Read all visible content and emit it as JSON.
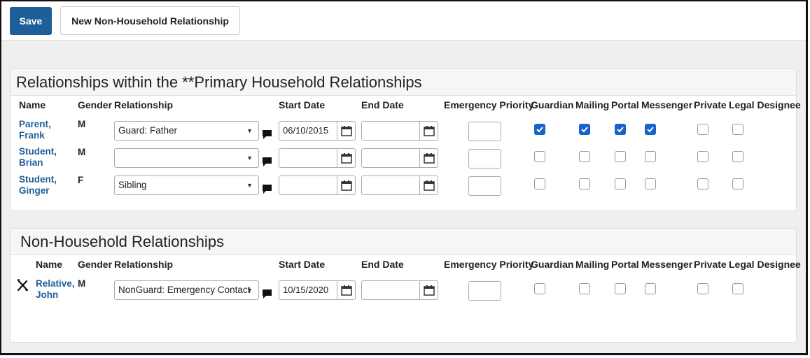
{
  "toolbar": {
    "save_label": "Save",
    "new_label": "New Non-Household Relationship"
  },
  "household": {
    "title": "Relationships within the **Primary Household Relationships",
    "headers": {
      "name": "Name",
      "gender": "Gender",
      "relationship": "Relationship",
      "start_date": "Start Date",
      "end_date": "End Date",
      "priority": "Emergency Priority",
      "guardian": "Guardian",
      "mailing": "Mailing",
      "portal": "Portal",
      "messenger": "Messenger",
      "private": "Private",
      "legal": "Legal Designee"
    },
    "rows": [
      {
        "name_line1": "Parent,",
        "name_line2": "Frank",
        "gender": "M",
        "relationship": "Guard: Father",
        "start_date": "06/10/2015",
        "end_date": "",
        "priority": "",
        "guardian": true,
        "mailing": true,
        "portal": true,
        "messenger": true,
        "private": false,
        "legal": false
      },
      {
        "name_line1": "Student,",
        "name_line2": "Brian",
        "gender": "M",
        "relationship": "",
        "start_date": "",
        "end_date": "",
        "priority": "",
        "guardian": false,
        "mailing": false,
        "portal": false,
        "messenger": false,
        "private": false,
        "legal": false
      },
      {
        "name_line1": "Student,",
        "name_line2": "Ginger",
        "gender": "F",
        "relationship": "Sibling",
        "start_date": "",
        "end_date": "",
        "priority": "",
        "guardian": false,
        "mailing": false,
        "portal": false,
        "messenger": false,
        "private": false,
        "legal": false
      }
    ]
  },
  "non_household": {
    "title": "Non-Household Relationships",
    "headers": {
      "name": "Name",
      "gender": "Gender",
      "relationship": "Relationship",
      "start_date": "Start Date",
      "end_date": "End Date",
      "priority": "Emergency Priority",
      "guardian": "Guardian",
      "mailing": "Mailing",
      "portal": "Portal",
      "messenger": "Messenger",
      "private": "Private",
      "legal": "Legal Designee"
    },
    "rows": [
      {
        "name_line1": "Relative,",
        "name_line2": "John",
        "gender": "M",
        "relationship": "NonGuard: Emergency Contact",
        "start_date": "10/15/2020",
        "end_date": "",
        "priority": "",
        "guardian": false,
        "mailing": false,
        "portal": false,
        "messenger": false,
        "private": false,
        "legal": false
      }
    ]
  },
  "icons": {
    "dropdown": "chevron-down-icon",
    "calendar": "calendar-icon",
    "comment": "comment-icon",
    "delete": "delete-x-icon"
  },
  "colors": {
    "primary": "#1e5f99",
    "checkbox_checked": "#1763c9",
    "background": "#efefef"
  }
}
